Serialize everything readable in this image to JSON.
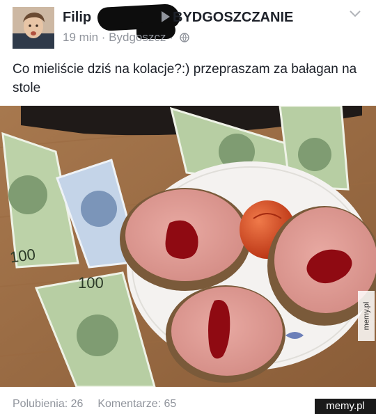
{
  "post": {
    "author_name": "Filip",
    "group_name": "BYDGOSZCZANIE",
    "time_ago": "19 min",
    "location": "Bydgoszcz",
    "text": "Co mieliście dziś na kolacje?:) przepraszam za bałagan na stole",
    "menu_icon": "chevron-down-icon",
    "privacy_icon": "globe-icon"
  },
  "photo": {
    "description_icon": "food-photo",
    "banknote_value": "100",
    "watermark": "memy.pl"
  },
  "footer": {
    "likes": "Polubienia: 26",
    "comments": "Komentarze: 65",
    "site_badge": "memy.pl"
  },
  "colors": {
    "text": "#1d2129",
    "secondary": "#90949c",
    "redaction": "#0d0d0d"
  }
}
